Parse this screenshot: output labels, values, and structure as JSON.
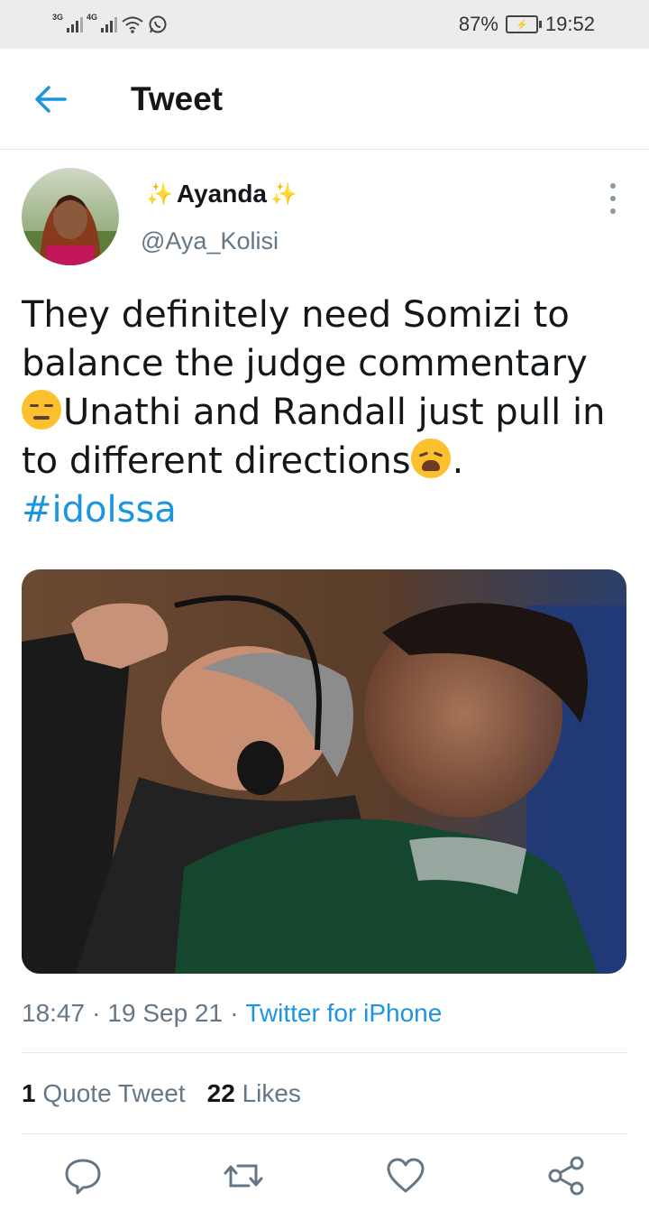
{
  "status_bar": {
    "network_1": "3G",
    "network_2": "4G",
    "battery": "87%",
    "time": "19:52"
  },
  "header": {
    "title": "Tweet"
  },
  "tweet": {
    "author_name": "Ayanda",
    "handle": "@Aya_Kolisi",
    "text": {
      "line1": "They definitely need Somizi to balance the judge commentary ",
      "line2": "Unathi and Randall just pull in to different directions",
      "line3": ".",
      "hashtag": "#idolssa"
    },
    "meta": {
      "time": "18:47",
      "separator": "·",
      "date": "19 Sep 21",
      "source": "Twitter for iPhone"
    },
    "stats": {
      "quote_count": "1",
      "quote_label": "Quote Tweet",
      "like_count": "22",
      "like_label": "Likes"
    }
  },
  "icons": [
    "back-arrow-icon",
    "more-vertical-icon",
    "sparkle-icon",
    "unamused-face-emoji",
    "weary-face-emoji",
    "reply-icon",
    "retweet-icon",
    "like-icon",
    "share-icon"
  ],
  "colors": {
    "accent": "#1b95e0",
    "text": "#14171a",
    "muted": "#657786",
    "divider": "#e1e8ed"
  }
}
